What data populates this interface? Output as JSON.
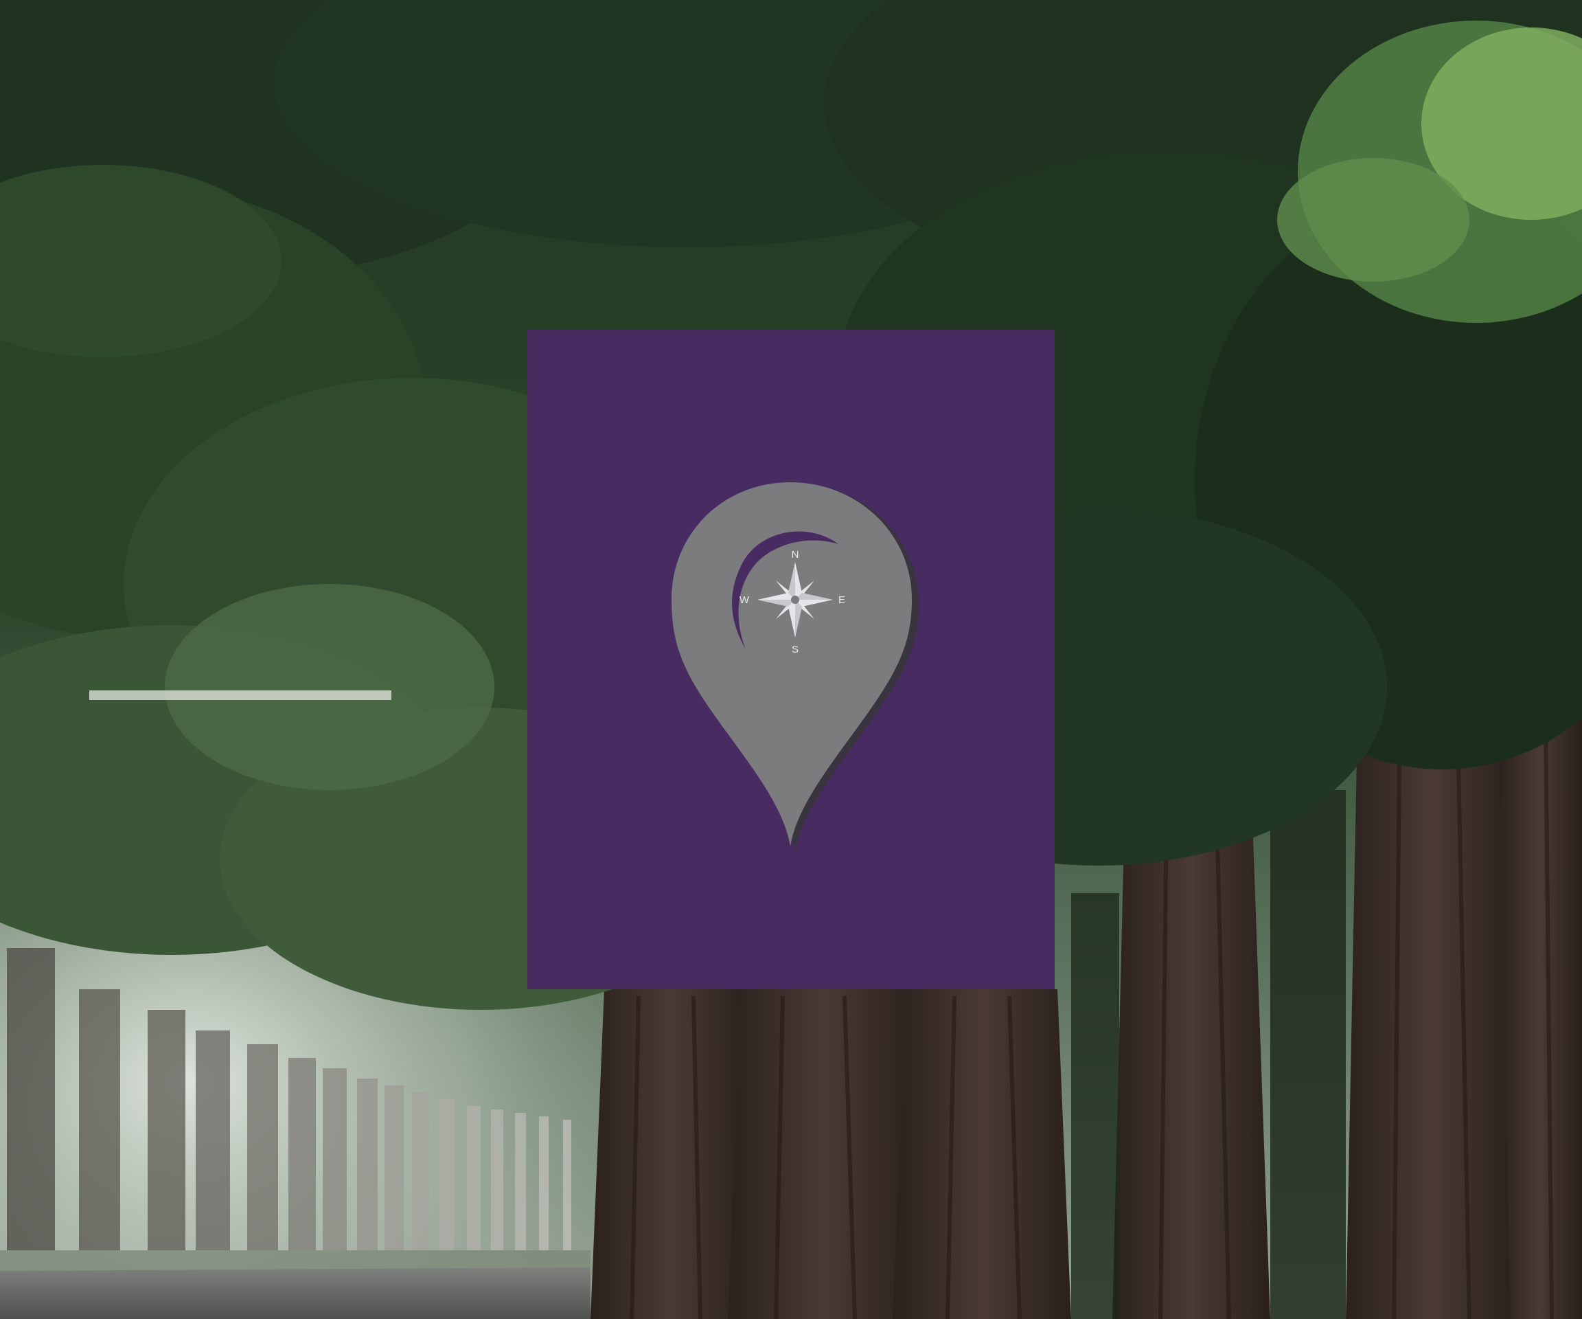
{
  "scene": {
    "description_icon": "map-pin-compass-icon"
  },
  "colors": {
    "poster_background": "#472b61",
    "pin_fill": "#7c7b7e",
    "pin_shadow": "#3a3440",
    "compass_star": "#e6e6e8",
    "crescent": "#472b61",
    "foliage_dark": "#1f3320",
    "foliage_mid": "#3c5a38",
    "foliage_light": "#6f9a5a",
    "trunk": "#3e302b",
    "fog": "#c9d2c6"
  },
  "compass": {
    "north": "N",
    "east": "E",
    "south": "S",
    "west": "W"
  }
}
